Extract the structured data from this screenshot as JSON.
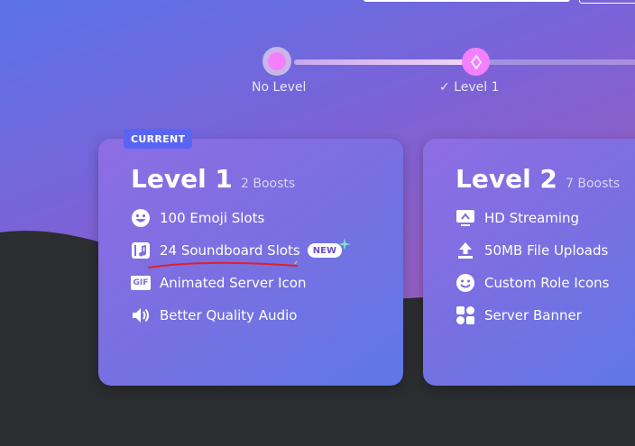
{
  "progress": {
    "levels": [
      {
        "label": "No Level",
        "state": "reached"
      },
      {
        "label": "Level 1",
        "state": "current",
        "checked": true
      }
    ],
    "check_glyph": "✓"
  },
  "cards": [
    {
      "badge": "CURRENT",
      "title": "Level 1",
      "boosts": "2 Boosts",
      "perks": [
        {
          "icon": "emoji-icon",
          "label": "100 Emoji Slots"
        },
        {
          "icon": "soundboard-icon",
          "label": "24 Soundboard Slots",
          "badge": "NEW"
        },
        {
          "icon": "gif-icon",
          "icon_text": "GIF",
          "label": "Animated Server Icon"
        },
        {
          "icon": "speaker-icon",
          "label": "Better Quality Audio"
        }
      ]
    },
    {
      "title": "Level 2",
      "boosts": "7 Boosts",
      "perks": [
        {
          "icon": "streaming-icon",
          "label": "HD Streaming"
        },
        {
          "icon": "upload-icon",
          "label": "50MB File Uploads"
        },
        {
          "icon": "role-icon",
          "label": "Custom Role Icons"
        },
        {
          "icon": "banner-icon",
          "label": "Server Banner"
        }
      ]
    }
  ],
  "colors": {
    "accent": "#5865f2",
    "track_fill": "#e0b8f2",
    "node_pink": "#f47fff",
    "annotation_red": "#e0202a",
    "dark_bg": "#2b2d31"
  }
}
